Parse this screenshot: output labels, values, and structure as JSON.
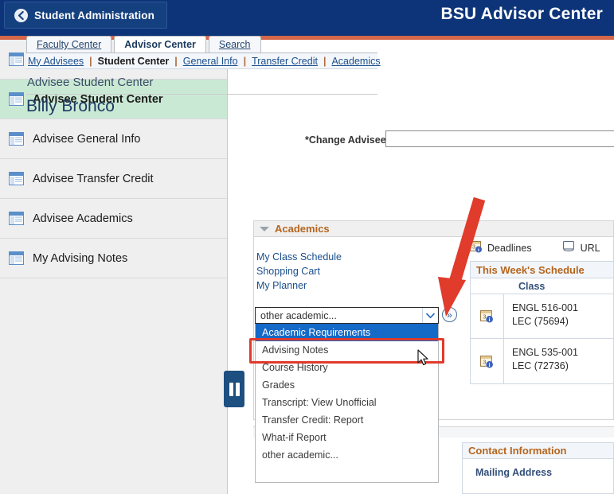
{
  "header": {
    "back_label": "Student Administration",
    "back_icon": "chevron-left-icon",
    "app_title": "BSU Advisor Center",
    "bg_color": "#0d3478",
    "accent_color": "#d4664a"
  },
  "sidebar": {
    "items": [
      {
        "label": "My Advisees",
        "icon": "window-page-icon",
        "selected": false
      },
      {
        "label": "Advisee Student Center",
        "icon": "window-page-icon",
        "selected": true
      },
      {
        "label": "Advisee General Info",
        "icon": "window-page-icon",
        "selected": false
      },
      {
        "label": "Advisee Transfer Credit",
        "icon": "window-page-icon",
        "selected": false
      },
      {
        "label": "Advisee Academics",
        "icon": "window-page-icon",
        "selected": false
      },
      {
        "label": "My Advising Notes",
        "icon": "window-page-icon",
        "selected": false
      }
    ],
    "selected_color": "#cae9d4",
    "bg_color": "#efeff0"
  },
  "collapse_handle": {
    "name": "pause-bars-icon"
  },
  "tabs": [
    {
      "label": "Faculty Center",
      "active": false
    },
    {
      "label": "Advisor Center",
      "active": true
    },
    {
      "label": "Search",
      "active": false
    }
  ],
  "subnav": {
    "items": [
      {
        "label": "My Advisees",
        "current": false
      },
      {
        "label": "Student Center",
        "current": true
      },
      {
        "label": "General Info",
        "current": false
      },
      {
        "label": "Transfer Credit",
        "current": false
      },
      {
        "label": "Academics",
        "current": false
      }
    ],
    "separator": "|"
  },
  "page": {
    "subtitle": "Advisee Student Center",
    "student_name": "Billy Bronco"
  },
  "change_advisee": {
    "label": "*Change Advisee",
    "value": "",
    "placeholder": ""
  },
  "academics": {
    "section_title": "Academics",
    "caret_icon": "caret-down-icon",
    "links": [
      "My Class Schedule",
      "Shopping Cart",
      "My Planner"
    ],
    "select": {
      "value": "other academic...",
      "arrow_icon": "chevron-down-icon",
      "go_icon": "double-chevron-right-icon",
      "go_label": "»",
      "options": [
        "Academic Requirements",
        "Advising Notes",
        "Course History",
        "Grades",
        "Transcript: View Unofficial",
        "Transfer Credit: Report",
        "What-if Report",
        "other academic..."
      ],
      "highlighted_option": "Academic Requirements",
      "highlight_box_color": "#e03b2b",
      "highlight_row_color": "#1569c7"
    }
  },
  "icon_row": [
    {
      "label": "Deadlines",
      "icon": "calendar-info-icon"
    },
    {
      "label": "URL",
      "icon": "url-link-icon"
    }
  ],
  "schedule": {
    "title": "This Week's Schedule",
    "column_header": "Class",
    "rows": [
      {
        "icon": "calendar-info-icon",
        "line1": "ENGL 516-001",
        "line2": "LEC (75694)"
      },
      {
        "icon": "calendar-info-icon",
        "line1": "ENGL 535-001",
        "line2": "LEC (72736)"
      }
    ]
  },
  "contact": {
    "title": "Contact Information",
    "mailing_address_label": "Mailing Address"
  },
  "annotations": {
    "arrow_color": "#e03b2b",
    "arrow_name": "red-annotation-arrow",
    "cursor_name": "mouse-cursor"
  }
}
